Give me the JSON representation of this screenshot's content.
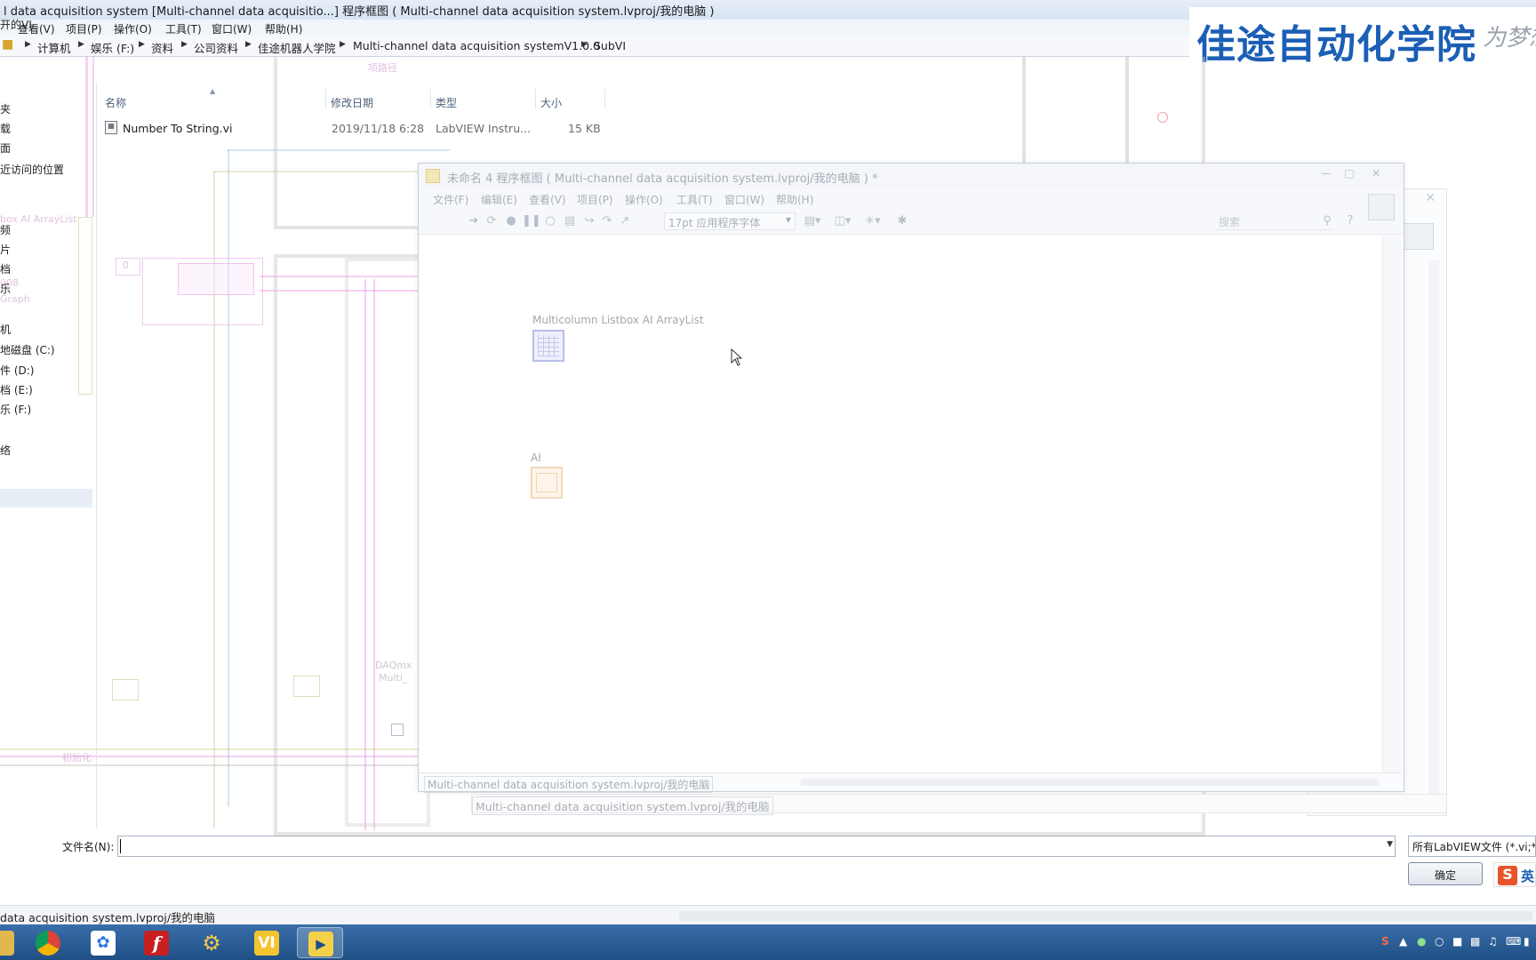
{
  "background_window": {
    "title": "l data acquisition system [Multi-channel data acquisitio...] 程序框图 ( Multi-channel data acquisition system.lvproj/我的电脑 )",
    "menu_first": "开的VI",
    "menu": [
      "查看(V)",
      "项目(P)",
      "操作(O)",
      "工具(T)",
      "窗口(W)",
      "帮助(H)"
    ]
  },
  "address_bar": {
    "crumbs": [
      "计算机",
      "娱乐 (F:)",
      "资料",
      "公司资料",
      "佳途机器人学院",
      "Multi-channel data acquisition systemV1.0.0",
      "SubVI"
    ]
  },
  "logo": {
    "text": "佳途自动化学院",
    "slogan": "为梦想"
  },
  "nav_pane": {
    "items": [
      "夹",
      "载",
      "面",
      "近访问的位置",
      "频",
      "片",
      "档",
      "乐",
      "机",
      "地磁盘 (C:)",
      "件 (D:)",
      "档 (E:)",
      "乐 (F:)",
      "络"
    ]
  },
  "file_list": {
    "columns": [
      "名称",
      "修改日期",
      "类型",
      "大小"
    ],
    "rows": [
      {
        "name": "Number To String.vi",
        "date": "2019/11/18 6:28",
        "type": "LabVIEW Instru...",
        "size": "15 KB"
      }
    ]
  },
  "diagram_faint_labels": {
    "listbox": "box AI ArrayList",
    "graph": "Graph",
    "idx": "008",
    "init": "初始化",
    "daqmx": "DAQmx",
    "multi": "Multi_",
    "zero1": "0",
    "path": "项路径"
  },
  "front_window": {
    "title": "未命名 4 程序框图 ( Multi-channel data acquisition system.lvproj/我的电脑 ) *",
    "menu": [
      "文件(F)",
      "编辑(E)",
      "查看(V)",
      "项目(P)",
      "操作(O)",
      "工具(T)",
      "窗口(W)",
      "帮助(H)"
    ],
    "font_select": "17pt 应用程序字体",
    "search_placeholder": "搜索",
    "nodes": [
      {
        "label": "Multicolumn Listbox AI ArrayList"
      },
      {
        "label": "AI"
      }
    ],
    "status": "Multi-channel data acquisition system.lvproj/我的电脑"
  },
  "second_window_status": "Multi-channel data acquisition system.lvproj/我的电脑",
  "file_dialog": {
    "filename_label": "文件名(N):",
    "filename_value": "",
    "filetype": "所有LabVIEW文件 (*.vi;*.ctl",
    "ok_label": "确定"
  },
  "bottom_status": "data acquisition system.lvproj/我的电脑",
  "ime": {
    "badge": "S",
    "mode": "英"
  },
  "taskbar": {
    "apps": [
      "explorer-icon",
      "chrome-icon",
      "baidu-netdisk-icon",
      "flash-icon",
      "tool-icon",
      "vi-icon",
      "labview-icon"
    ],
    "vi_label": "VI"
  },
  "colors": {
    "logo_blue": "#1b5fb5",
    "taskbar": "#2b5e99",
    "wire_pink": "#e678dc"
  }
}
